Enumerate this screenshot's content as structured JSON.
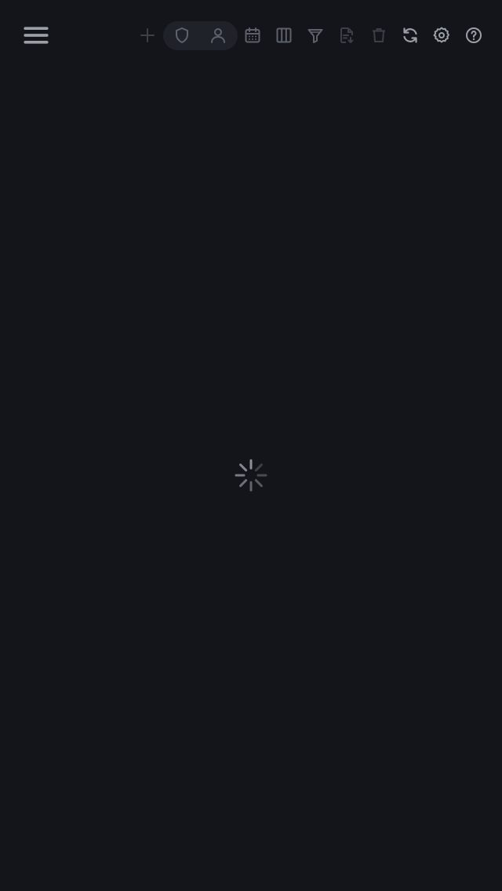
{
  "toolbar": {
    "menu_icon": "menu-icon",
    "buttons": [
      {
        "icon": "plus-icon"
      },
      {
        "icon": "shield-icon"
      },
      {
        "icon": "user-icon"
      },
      {
        "icon": "calendar-icon"
      },
      {
        "icon": "columns-icon"
      },
      {
        "icon": "filter-icon"
      },
      {
        "icon": "document-export-icon"
      },
      {
        "icon": "trash-icon"
      },
      {
        "icon": "refresh-icon"
      },
      {
        "icon": "settings-icon"
      },
      {
        "icon": "help-icon"
      }
    ]
  },
  "main": {
    "state": "loading"
  },
  "colors": {
    "background": "#13151a",
    "toggle_group_bg": "#1f2229",
    "icon_dim": "#3b3f47",
    "icon_mid": "#5c616b",
    "icon_bright": "#9aa0a8",
    "spinner": "#8a8f98"
  }
}
